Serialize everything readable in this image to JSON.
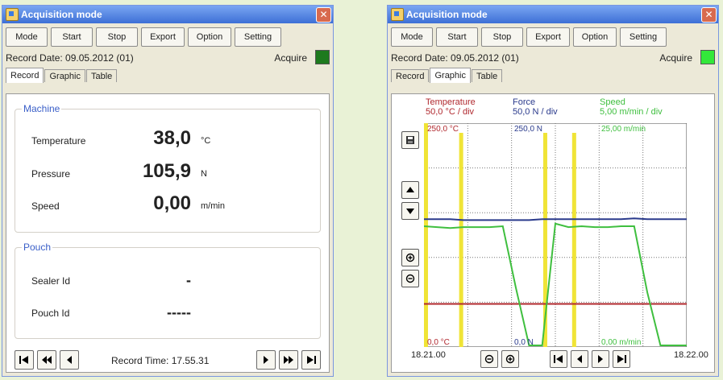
{
  "colors": {
    "title_bar": "#3d6fd6",
    "led_dark": "#1e7a1e",
    "led_bright": "#33e83a",
    "temperature": "#b0282e",
    "force": "#2a3a8c",
    "speed": "#3fbf3f",
    "marker": "#f0e436",
    "group_label": "#3a5fc8"
  },
  "windows": [
    {
      "title": "Acquisition mode",
      "toolbar": [
        "Mode",
        "Start",
        "Stop",
        "Export",
        "Option",
        "Setting"
      ],
      "record_date": "Record Date: 09.05.2012 (01)",
      "acquire_label": "Acquire",
      "led_color": "#1e7a1e",
      "tabs": [
        "Record",
        "Graphic",
        "Table"
      ],
      "active_tab": "Record",
      "machine": {
        "label": "Machine",
        "rows": [
          {
            "label": "Temperature",
            "value": "38,0",
            "unit": "°C"
          },
          {
            "label": "Pressure",
            "value": "105,9",
            "unit": "N"
          },
          {
            "label": "Speed",
            "value": "0,00",
            "unit": "m/min"
          }
        ]
      },
      "pouch": {
        "label": "Pouch",
        "rows": [
          {
            "label": "Sealer Id",
            "value": "-"
          },
          {
            "label": "Pouch Id",
            "value": "-----"
          }
        ]
      },
      "record_time": "Record Time: 17.55.31"
    },
    {
      "title": "Acquisition mode",
      "toolbar": [
        "Mode",
        "Start",
        "Stop",
        "Export",
        "Option",
        "Setting"
      ],
      "record_date": "Record Date: 09.05.2012 (01)",
      "acquire_label": "Acquire",
      "led_color": "#33e83a",
      "tabs": [
        "Record",
        "Graphic",
        "Table"
      ],
      "active_tab": "Graphic",
      "channels": [
        {
          "name": "Temperature",
          "scale": "50,0 °C / div",
          "top_label": "250,0 °C",
          "bottom_label": "0,0 °C",
          "color": "#b0282e"
        },
        {
          "name": "Force",
          "scale": "50,0 N / div",
          "top_label": "250,0 N",
          "bottom_label": "0,0 N",
          "color": "#2a3a8c"
        },
        {
          "name": "Speed",
          "scale": "5,00 m/min / div",
          "top_label": "25,00 m/min",
          "bottom_label": "0,00 m/min",
          "color": "#3fbf3f"
        }
      ],
      "time_start": "18.21.00",
      "time_end": "18.22.00"
    }
  ],
  "chart_data": {
    "type": "line",
    "x_range": [
      "18.21.00",
      "18.22.00"
    ],
    "x_fraction": [
      0.0,
      0.05,
      0.1,
      0.15,
      0.2,
      0.25,
      0.3,
      0.35,
      0.4,
      0.45,
      0.5,
      0.55,
      0.6,
      0.65,
      0.7,
      0.75,
      0.8,
      0.85,
      0.9,
      0.95,
      1.0
    ],
    "series": [
      {
        "name": "Temperature",
        "unit": "°C",
        "ylim": [
          0,
          250
        ],
        "values": [
          47,
          47,
          47,
          47,
          47,
          47,
          47,
          47,
          47,
          47,
          47,
          47,
          47,
          47,
          47,
          47,
          47,
          47,
          47,
          47,
          47
        ]
      },
      {
        "name": "Force",
        "unit": "N",
        "ylim": [
          0,
          250
        ],
        "values": [
          143,
          143,
          143,
          142,
          142,
          142,
          142,
          142,
          142,
          143,
          143,
          143,
          143,
          143,
          143,
          143,
          144,
          143,
          143,
          143,
          143
        ]
      },
      {
        "name": "Speed",
        "unit": "m/min",
        "ylim": [
          0,
          25
        ],
        "values": [
          13.5,
          13.4,
          13.3,
          13.4,
          13.4,
          13.4,
          13.5,
          6.5,
          0.0,
          0.0,
          13.8,
          13.4,
          13.5,
          13.4,
          13.4,
          13.5,
          13.5,
          6.0,
          0.0,
          0.0,
          0.0
        ]
      }
    ],
    "markers_fraction": [
      0.14,
      0.46,
      0.57
    ],
    "grid": true,
    "legend": "top"
  }
}
